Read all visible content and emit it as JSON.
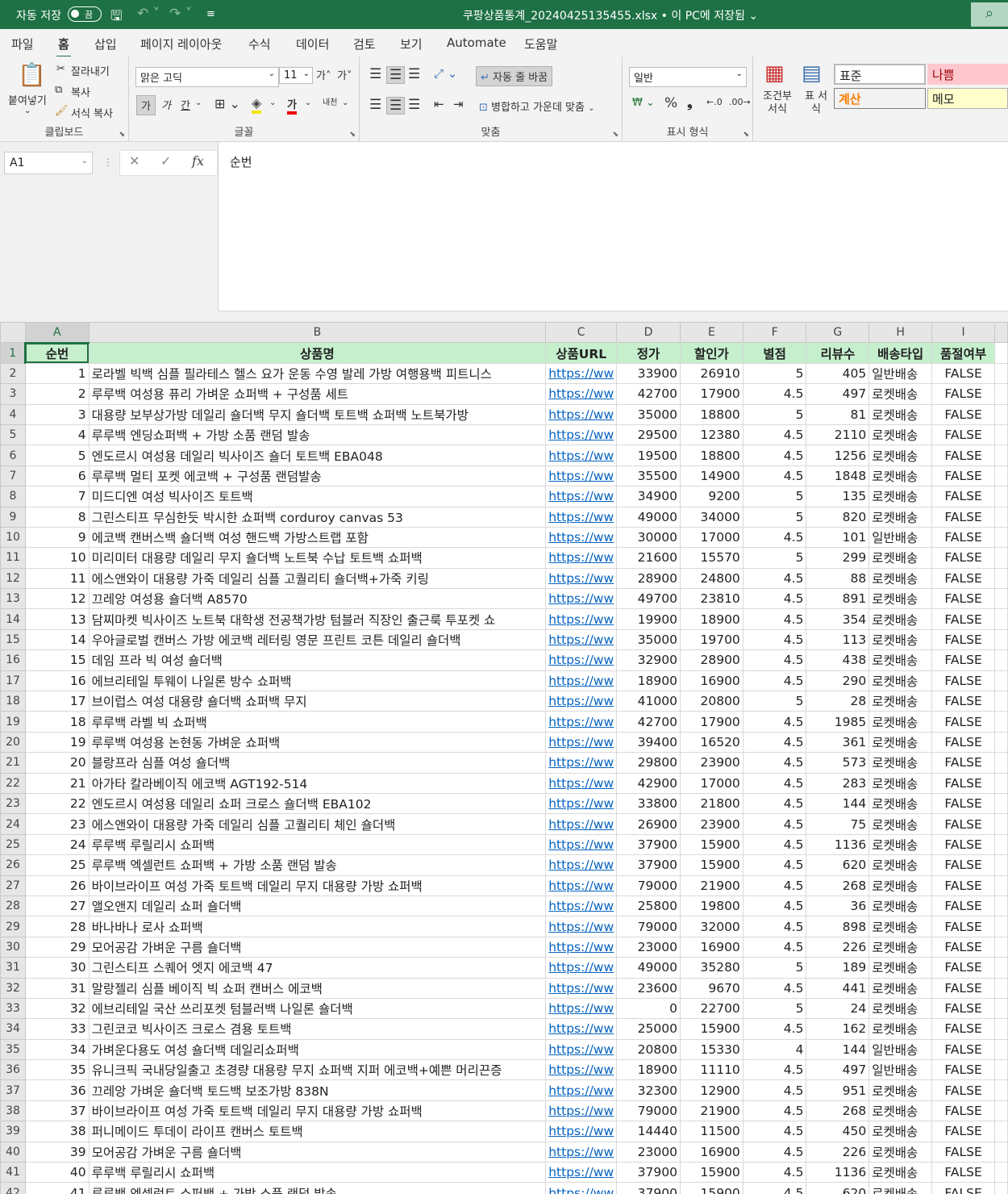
{
  "titlebar": {
    "autosave_label": "자동 저장",
    "autosave_toggle": "끔",
    "filename": "쿠팡상품통계_20240425135455.xlsx",
    "save_status": "이 PC에 저장됨"
  },
  "menu": [
    "파일",
    "홈",
    "삽입",
    "페이지 레이아웃",
    "수식",
    "데이터",
    "검토",
    "보기",
    "Automate",
    "도움말"
  ],
  "active_tab": "홈",
  "ribbon": {
    "clipboard": {
      "label": "클립보드",
      "paste": "붙여넣기",
      "cut": "잘라내기",
      "copy": "복사",
      "format_painter": "서식 복사"
    },
    "font": {
      "label": "글꼴",
      "font_name": "맑은 고딕",
      "font_size": "11",
      "bold": "가",
      "italic": "가",
      "underline": "간",
      "phonetic": "내천"
    },
    "align": {
      "label": "맞춤",
      "wrap": "자동 줄 바꿈",
      "merge": "병합하고 가운데 맞춤"
    },
    "number": {
      "label": "표시 형식",
      "format": "일반"
    },
    "styles": {
      "cond_fmt": "조건부 서식",
      "table_fmt": "표 서식",
      "normal": "표준",
      "bad": "나쁨",
      "calc": "계산",
      "memo": "메모"
    }
  },
  "formula_bar": {
    "name_box": "A1",
    "content": "순번"
  },
  "sheet": {
    "columns": [
      "A",
      "B",
      "C",
      "D",
      "E",
      "F",
      "G",
      "H",
      "I"
    ],
    "header": [
      "순번",
      "상품명",
      "상품URL",
      "정가",
      "할인가",
      "별점",
      "리뷰수",
      "배송타입",
      "품절여부"
    ],
    "rows": [
      [
        "1",
        "로라벨 빅백 심플 필라테스 헬스 요가 운동 수영 발레 가방 여행용백 피트니스",
        "https://ww",
        "33900",
        "26910",
        "5",
        "405",
        "일반배송",
        "FALSE"
      ],
      [
        "2",
        "루루백 여성용 퓨리 가벼운 쇼퍼백 + 구성품 세트",
        "https://ww",
        "42700",
        "17900",
        "4.5",
        "497",
        "로켓배송",
        "FALSE"
      ],
      [
        "3",
        "대용량 보부상가방 데일리 숄더백 무지 숄더백 토트백 쇼퍼백 노트북가방",
        "https://ww",
        "35000",
        "18800",
        "5",
        "81",
        "로켓배송",
        "FALSE"
      ],
      [
        "4",
        "루루백 엔딩쇼퍼백 + 가방 소품 랜덤 발송",
        "https://ww",
        "29500",
        "12380",
        "4.5",
        "2110",
        "로켓배송",
        "FALSE"
      ],
      [
        "5",
        "엔도르시 여성용 데일리 빅사이즈 숄더 토트백 EBA048",
        "https://ww",
        "19500",
        "18800",
        "4.5",
        "1256",
        "로켓배송",
        "FALSE"
      ],
      [
        "6",
        "루루백 멀티 포켓 에코백 + 구성품 랜덤발송",
        "https://ww",
        "35500",
        "14900",
        "4.5",
        "1848",
        "로켓배송",
        "FALSE"
      ],
      [
        "7",
        "미드디엔 여성 빅사이즈 토트백",
        "https://ww",
        "34900",
        "9200",
        "5",
        "135",
        "로켓배송",
        "FALSE"
      ],
      [
        "8",
        "그린스티프 무심한듯 박시한 쇼퍼백 corduroy canvas 53",
        "https://ww",
        "49000",
        "34000",
        "5",
        "820",
        "로켓배송",
        "FALSE"
      ],
      [
        "9",
        "에코백 캔버스백 숄더백 여성 핸드백 가방스트랩 포함",
        "https://ww",
        "30000",
        "17000",
        "4.5",
        "101",
        "일반배송",
        "FALSE"
      ],
      [
        "10",
        "미리미터 대용량 데일리 무지 숄더백 노트북 수납 토트백 쇼퍼백",
        "https://ww",
        "21600",
        "15570",
        "5",
        "299",
        "로켓배송",
        "FALSE"
      ],
      [
        "11",
        "에스앤와이 대용량 가죽 데일리 심플 고퀄리티 숄더백+가죽 키링",
        "https://ww",
        "28900",
        "24800",
        "4.5",
        "88",
        "로켓배송",
        "FALSE"
      ],
      [
        "12",
        "끄레앙 여성용 숄더백 A8570",
        "https://ww",
        "49700",
        "23810",
        "4.5",
        "891",
        "로켓배송",
        "FALSE"
      ],
      [
        "13",
        "담찌마켓 빅사이즈 노트북 대학생 전공책가방 텀블러 직장인 출근룩 투포켓 쇼",
        "https://ww",
        "19900",
        "18900",
        "4.5",
        "354",
        "로켓배송",
        "FALSE"
      ],
      [
        "14",
        "우아글로벌 캔버스 가방 에코백 레터링 영문 프린트 코튼 데일리 숄더백",
        "https://ww",
        "35000",
        "19700",
        "4.5",
        "113",
        "로켓배송",
        "FALSE"
      ],
      [
        "15",
        "데임 프라 빅 여성 숄더백",
        "https://ww",
        "32900",
        "28900",
        "4.5",
        "438",
        "로켓배송",
        "FALSE"
      ],
      [
        "16",
        "에브리테일 투웨이 나일론 방수 쇼퍼백",
        "https://ww",
        "18900",
        "16900",
        "4.5",
        "290",
        "로켓배송",
        "FALSE"
      ],
      [
        "17",
        "브이럽스 여성 대용량 숄더백 쇼퍼백 무지",
        "https://ww",
        "41000",
        "20800",
        "5",
        "28",
        "로켓배송",
        "FALSE"
      ],
      [
        "18",
        "루루백 라벨 빅 쇼퍼백",
        "https://ww",
        "42700",
        "17900",
        "4.5",
        "1985",
        "로켓배송",
        "FALSE"
      ],
      [
        "19",
        "루루백 여성용 논현동 가벼운 쇼퍼백",
        "https://ww",
        "39400",
        "16520",
        "4.5",
        "361",
        "로켓배송",
        "FALSE"
      ],
      [
        "20",
        "블랑프라 심플 여성 숄더백",
        "https://ww",
        "29800",
        "23900",
        "4.5",
        "573",
        "로켓배송",
        "FALSE"
      ],
      [
        "21",
        "아가타 칼라베이직 에코백 AGT192-514",
        "https://ww",
        "42900",
        "17000",
        "4.5",
        "283",
        "로켓배송",
        "FALSE"
      ],
      [
        "22",
        "엔도르시 여성용 데일리 쇼퍼 크로스 숄더백 EBA102",
        "https://ww",
        "33800",
        "21800",
        "4.5",
        "144",
        "로켓배송",
        "FALSE"
      ],
      [
        "23",
        "에스앤와이 대용량 가죽 데일리 심플 고퀄리티 체인 숄더백",
        "https://ww",
        "26900",
        "23900",
        "4.5",
        "75",
        "로켓배송",
        "FALSE"
      ],
      [
        "24",
        "루루백 루릴리시 쇼퍼백",
        "https://ww",
        "37900",
        "15900",
        "4.5",
        "1136",
        "로켓배송",
        "FALSE"
      ],
      [
        "25",
        "루루백 엑셀런트 쇼퍼백 + 가방 소품 랜덤 발송",
        "https://ww",
        "37900",
        "15900",
        "4.5",
        "620",
        "로켓배송",
        "FALSE"
      ],
      [
        "26",
        "바이브라이프 여성 가죽 토트백 데일리 무지 대용량 가방 쇼퍼백",
        "https://ww",
        "79000",
        "21900",
        "4.5",
        "268",
        "로켓배송",
        "FALSE"
      ],
      [
        "27",
        "앨오앤지 데일리 쇼퍼 숄더백",
        "https://ww",
        "25800",
        "19800",
        "4.5",
        "36",
        "로켓배송",
        "FALSE"
      ],
      [
        "28",
        "바나바나 로사 쇼퍼백",
        "https://ww",
        "79000",
        "32000",
        "4.5",
        "898",
        "로켓배송",
        "FALSE"
      ],
      [
        "29",
        "모어공감 가벼운 구름 숄더백",
        "https://ww",
        "23000",
        "16900",
        "4.5",
        "226",
        "로켓배송",
        "FALSE"
      ],
      [
        "30",
        "그린스티프 스퀘어 엣지 에코백 47",
        "https://ww",
        "49000",
        "35280",
        "5",
        "189",
        "로켓배송",
        "FALSE"
      ],
      [
        "31",
        "말랑젤리 심플 베이직 빅 쇼퍼 캔버스 에코백",
        "https://ww",
        "23600",
        "9670",
        "4.5",
        "441",
        "로켓배송",
        "FALSE"
      ],
      [
        "32",
        "에브리테일 국산 쓰리포켓 텀블러백 나일론 숄더백",
        "https://ww",
        "0",
        "22700",
        "5",
        "24",
        "로켓배송",
        "FALSE"
      ],
      [
        "33",
        "그린코코 빅사이즈 크로스 겸용 토트백",
        "https://ww",
        "25000",
        "15900",
        "4.5",
        "162",
        "로켓배송",
        "FALSE"
      ],
      [
        "34",
        "가벼운다용도 여성 숄더백 데일리쇼퍼백",
        "https://ww",
        "20800",
        "15330",
        "4",
        "144",
        "일반배송",
        "FALSE"
      ],
      [
        "35",
        "유니크픽 국내당일출고 초경량 대용량 무지 쇼퍼백 지퍼 에코백+예쁜 머리끈증",
        "https://ww",
        "18900",
        "11110",
        "4.5",
        "497",
        "일반배송",
        "FALSE"
      ],
      [
        "36",
        "끄레앙 가벼운 숄더백 토드백 보조가방 838N",
        "https://ww",
        "32300",
        "12900",
        "4.5",
        "951",
        "로켓배송",
        "FALSE"
      ],
      [
        "37",
        "바이브라이프 여성 가죽 토트백 데일리 무지 대용량 가방 쇼퍼백",
        "https://ww",
        "79000",
        "21900",
        "4.5",
        "268",
        "로켓배송",
        "FALSE"
      ],
      [
        "38",
        "퍼니메이드 투데이 라이프 캔버스 토트백",
        "https://ww",
        "14440",
        "11500",
        "4.5",
        "450",
        "로켓배송",
        "FALSE"
      ],
      [
        "39",
        "모어공감 가벼운 구름 숄더백",
        "https://ww",
        "23000",
        "16900",
        "4.5",
        "226",
        "로켓배송",
        "FALSE"
      ],
      [
        "40",
        "루루백 루릴리시 쇼퍼백",
        "https://ww",
        "37900",
        "15900",
        "4.5",
        "1136",
        "로켓배송",
        "FALSE"
      ],
      [
        "41",
        "루루백 엑셀런트 쇼퍼백 + 가방 소품 랜덤 발송",
        "https://ww",
        "37900",
        "15900",
        "4.5",
        "620",
        "로켓배송",
        "FALSE"
      ]
    ]
  }
}
